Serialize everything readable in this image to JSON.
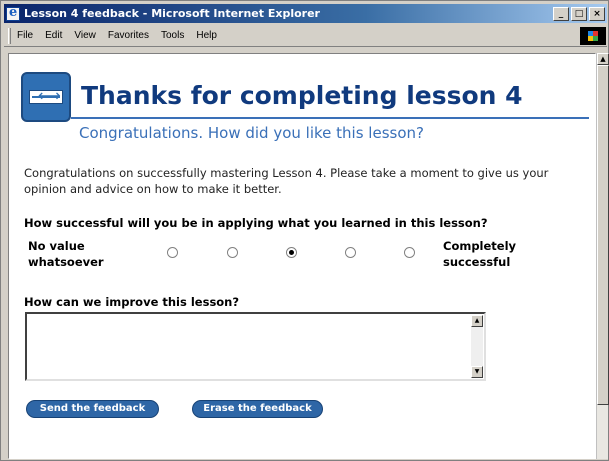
{
  "window": {
    "title": "Lesson 4 feedback - Microsoft Internet Explorer",
    "controls": {
      "minimize": "_",
      "maximize": "□",
      "close": "×"
    }
  },
  "menubar": {
    "items": [
      "File",
      "Edit",
      "View",
      "Favorites",
      "Tools",
      "Help"
    ]
  },
  "page": {
    "title": "Thanks for completing lesson 4",
    "subtitle": "Congratulations. How did you like this lesson?",
    "intro": "Congratulations on successfully mastering Lesson 4. Please take a moment to give us your opinion and advice on how to make it better.",
    "question1": "How successful will you be in applying what you learned in this lesson?",
    "scale": {
      "low_label": "No value whatsoever",
      "high_label": "Completely successful",
      "options": 5,
      "selected_index": 2
    },
    "question2": "How can we improve this lesson?",
    "feedback_value": "",
    "send_label": "Send the feedback",
    "erase_label": "Erase the feedback"
  },
  "icons": {
    "browser": "ie-icon",
    "header": "ruler-icon"
  },
  "colors": {
    "title_blue": "#103a7e",
    "accent_blue": "#3a70b8",
    "button_blue": "#2e66a6"
  }
}
